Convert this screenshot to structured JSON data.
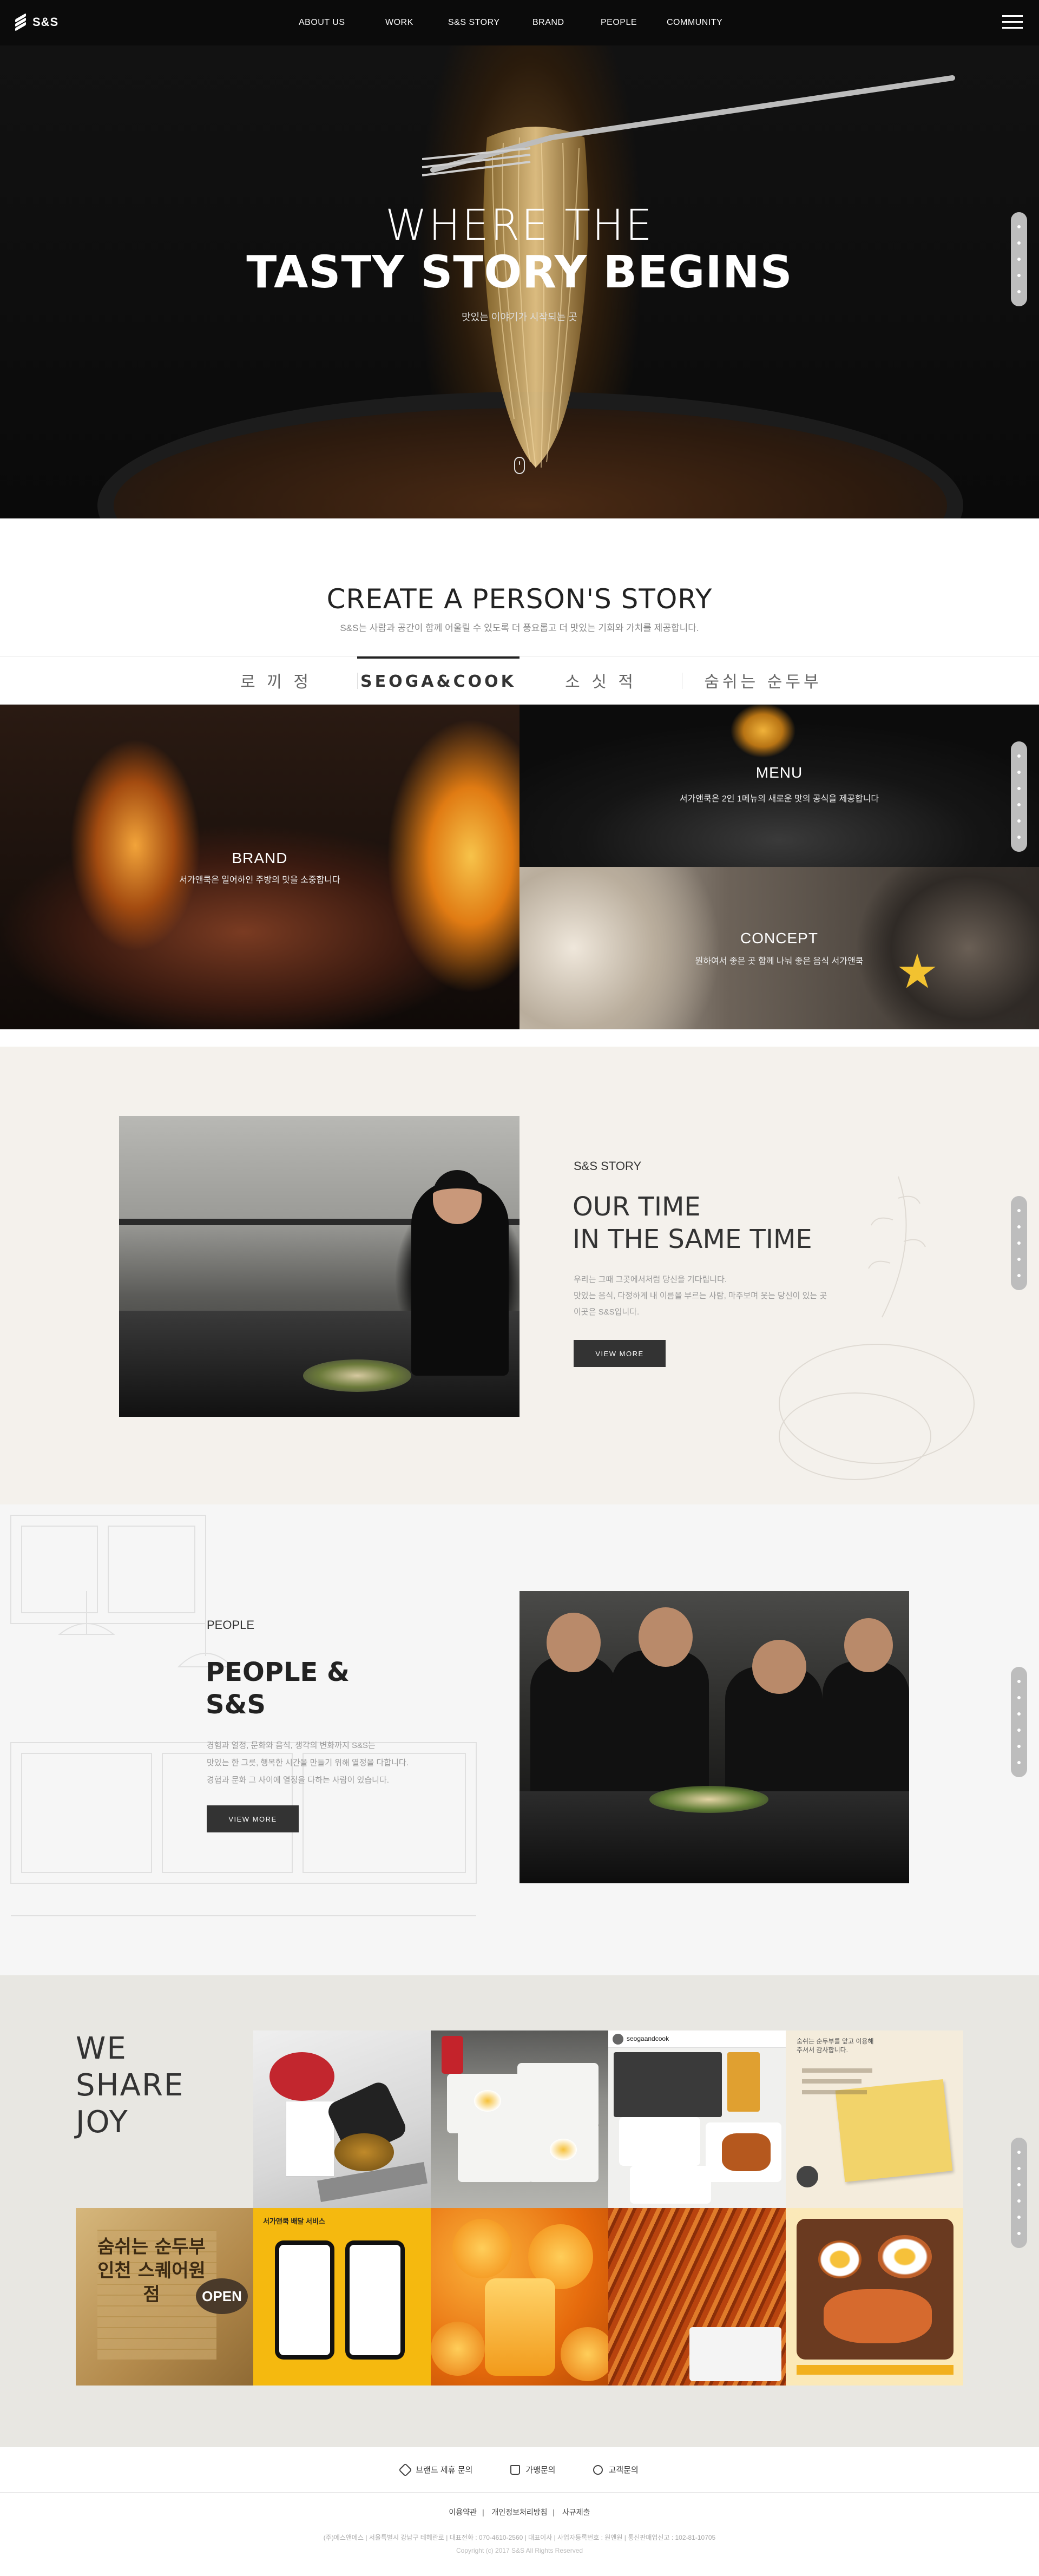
{
  "header": {
    "logo_text": "S&S",
    "nav": [
      "ABOUT US",
      "WORK",
      "S&S STORY",
      "BRAND",
      "PEOPLE",
      "COMMUNITY"
    ]
  },
  "hero": {
    "title_line1": "WHERE THE",
    "title_line2": "TASTY STORY BEGINS",
    "subtitle": "맛있는 이야기가 시작되는 곳"
  },
  "create": {
    "title": "CREATE A PERSON'S STORY",
    "subtitle": "S&S는 사람과 공간이 함께 어울릴 수 있도록 더 풍요롭고 더 맛있는 기회와 가치를 제공합니다.",
    "tabs": [
      "로 끼 정",
      "SEOGA&COOK",
      "소 싯 적",
      "숨쉬는 순두부"
    ],
    "active_tab_index": 1,
    "tiles": {
      "brand": {
        "title": "BRAND",
        "desc": "서가앤쿡은 일어하인 주방의 맛을 소중합니다"
      },
      "menu": {
        "title": "MENU",
        "desc": "서가앤쿡은 2인 1메뉴의 새로운 맛의 공식을 제공합니다"
      },
      "concept": {
        "title": "CONCEPT",
        "desc": "원하여서 좋은 곳 함께 나눠 좋은 음식 서가앤쿡"
      }
    }
  },
  "story": {
    "label": "S&S STORY",
    "title_line1": "OUR TIME",
    "title_line2": "IN THE SAME TIME",
    "desc": [
      "우리는 그때 그곳에서처럼 당신을 기다립니다.",
      "맛있는 음식, 다정하게 내 이름을 부르는 사람, 마주보며 웃는 당신이 있는 곳",
      "이곳은 S&S입니다."
    ],
    "button": "VIEW MORE"
  },
  "people": {
    "label": "PEOPLE",
    "title_line1": "PEOPLE &",
    "title_line2": "S&S",
    "desc": [
      "경험과 열정, 문화와 음식, 생각의 변화까지 S&S는",
      "맛있는 한 그릇, 행복한 시간을 만들기 위해 열정을 다합니다.",
      "경험과 문화 그 사이에 열정을 다하는 사람이 있습니다."
    ],
    "button": "VIEW MORE"
  },
  "share": {
    "title": [
      "WE",
      "SHARE",
      "JOY"
    ],
    "posts": [
      {
        "caption": "seogaandcook"
      },
      {
        "caption": "숨쉬는 순두부를 앞고 이용해주셔서 감사합니다."
      },
      {
        "caption": "숨쉬는 순두부 인천 스퀘어원점"
      },
      {
        "caption": "서가앤쿡 배달 서비스"
      },
      {
        "caption": "OPEN"
      }
    ]
  },
  "footer": {
    "links": [
      "브랜드 제휴 문의",
      "가맹문의",
      "고객문의"
    ],
    "policies": [
      "이용약관",
      "개인정보처리방침",
      "사규제출"
    ],
    "info": "(주)에스앤에스 | 서울특별시 강남구 테헤란로 | 대표전화 : 070-4610-2560 | 대표이사 | 사업자등록번호 : 원앤원 | 통신판매업신고 : 102-81-10705",
    "copyright": "Copyright (c) 2017 S&S All Rights Reserved"
  }
}
